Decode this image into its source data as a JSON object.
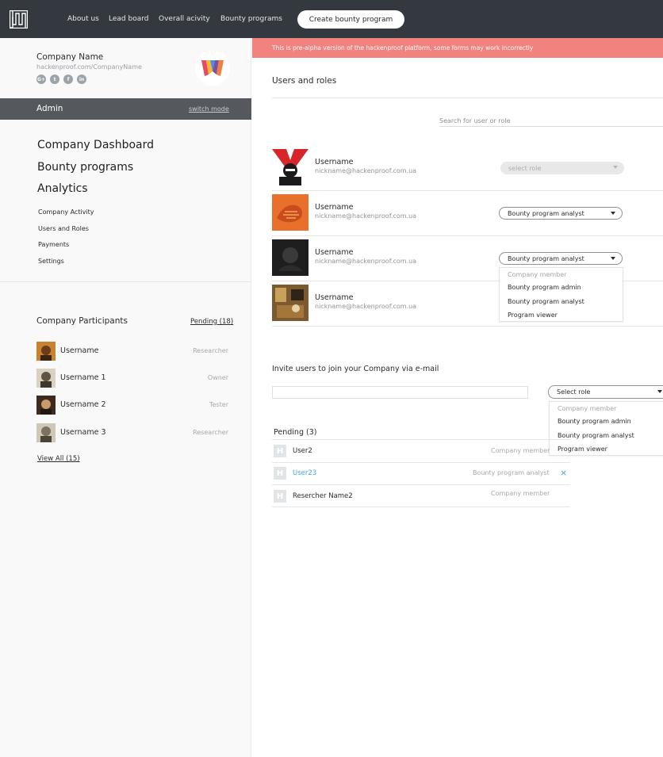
{
  "topbar": {
    "nav": [
      "About us",
      "Lead board",
      "Overall acivity",
      "Bounty programs"
    ],
    "create_button": "Create bounty program"
  },
  "sidebar": {
    "company_name": "Company Name",
    "company_url": "hackenproof.com/CompanyName",
    "socials": [
      "G+",
      "t",
      "f",
      "in"
    ],
    "mode": "Admin",
    "switch_mode": "switch mode",
    "big_links": [
      "Company Dashboard",
      "Bounty programs",
      "Analytics"
    ],
    "small_links": [
      "Company Activity",
      "Users and Roles",
      "Payments",
      "Settings"
    ],
    "participants_title": "Company Participants",
    "pending_link": "Pending (18)",
    "participants": [
      {
        "name": "Username",
        "role": "Researcher"
      },
      {
        "name": "Username 1",
        "role": "Owner"
      },
      {
        "name": "Username 2",
        "role": "Tester"
      },
      {
        "name": "Username 3",
        "role": "Researcher"
      }
    ],
    "view_all": "View All (15)"
  },
  "alert": "This is pre-alpha version of the hackenproof platform, some forms may work incorrectly",
  "main": {
    "title": "Users and roles",
    "search_placeholder": "Search for user or role",
    "users": [
      {
        "name": "Username",
        "email": "nickname@hackenproof.com.ua",
        "role": "select role"
      },
      {
        "name": "Username",
        "email": "nickname@hackenproof.com.ua",
        "role": "Bounty program analyst"
      },
      {
        "name": "Username",
        "email": "nickname@hackenproof.com.ua",
        "role": "Bounty program analyst"
      },
      {
        "name": "Username",
        "email": "nickname@hackenproof.com.ua",
        "role": ""
      }
    ],
    "role_options": [
      "Company member",
      "Bounty program admin",
      "Bounty program analyst",
      "Program viewer"
    ],
    "invite_title": "Invite users to join your Company via e-mail",
    "invite_role": "Select role",
    "pending_title": "Pending (3)",
    "pending": [
      {
        "name": "User2",
        "role": "Company member"
      },
      {
        "name": "User23",
        "role": "Bounty program analyst",
        "remove": "×"
      },
      {
        "name": "Resercher Name2",
        "role": "Company member"
      }
    ],
    "pending_icon_letter": "H"
  },
  "colors": {
    "topbar": "#34393f",
    "alert": "#f2827e",
    "admin_bar": "#55595e",
    "link_blue": "#4aa3df"
  }
}
